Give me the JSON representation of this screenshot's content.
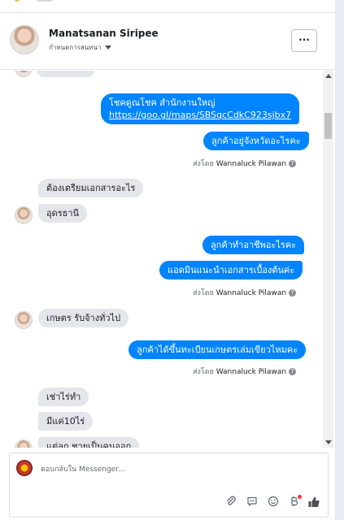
{
  "header": {
    "name": "Manatsanan Siripee",
    "sub": "กำหนดการสนทนา",
    "more_label": "···"
  },
  "messages": [
    {
      "text": "โชคดูณโชค สำนักงานใหญ่",
      "link": "https://goo.gl/maps/SBSqcCdkC923sjbx7"
    },
    {
      "text": "ลูกค้าอยู่จังหวัดอะไรคะ"
    },
    {
      "text": "ต้องเตรียมเอกสารอะไร"
    },
    {
      "text": "อุดรธานี"
    },
    {
      "text": "ลูกค้าทำอาชีพอะไรคะ"
    },
    {
      "text": "แอดมินแนะนำเอกสารเบื้องต้นค่ะ"
    },
    {
      "text": "เกษตร   รับจ้างทั่วไป"
    },
    {
      "text": "ลูกค้าได้ขึ้นทะเบียนเกษตรเล่มเขียวไหมคะ"
    },
    {
      "text": "เช่าไร่ทำ"
    },
    {
      "text": "มีแค่10ไร่"
    },
    {
      "text": "แต่ลูก ชายเป็นคนออก"
    }
  ],
  "sent_by": {
    "prefix": "ส่งโดย",
    "name": "Wannaluck Pilawan",
    "info": "?"
  },
  "composer": {
    "placeholder": "ตอบกลับใน Messenger...",
    "icons": [
      "attachment-icon",
      "gif-icon",
      "emoji-icon",
      "bitcoin-icon",
      "like-icon"
    ]
  },
  "colors": {
    "outgoing": "#0084ff",
    "incoming": "#e4e6eb",
    "notification_dot": "#fa383e"
  }
}
